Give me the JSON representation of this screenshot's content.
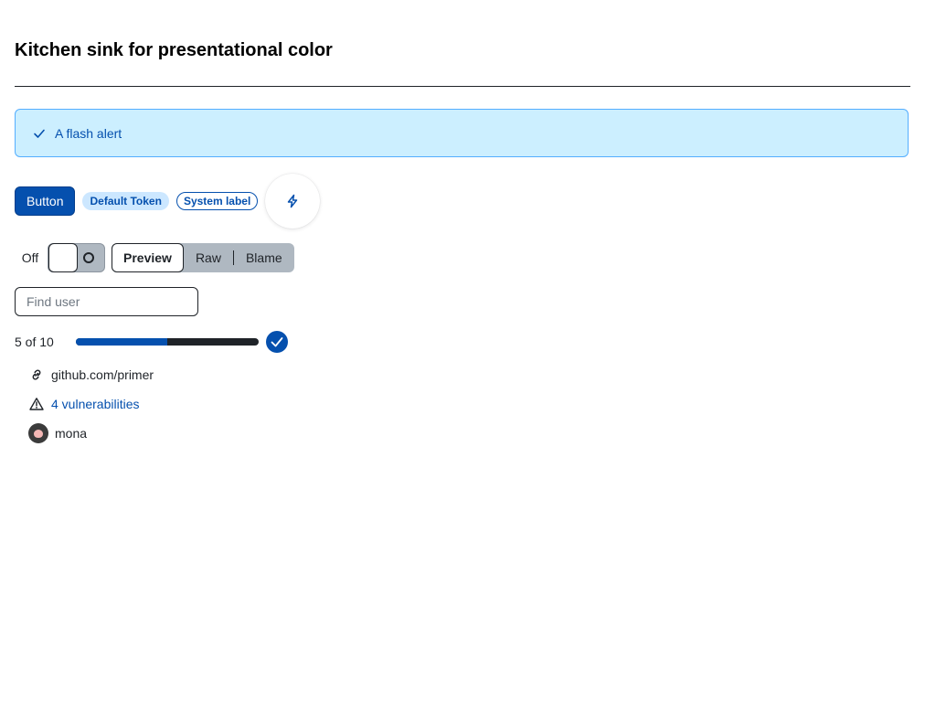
{
  "page_title": "Kitchen sink for presentational color",
  "flash": {
    "message": "A flash alert",
    "icon": "check-icon"
  },
  "actions": {
    "button_label": "Button",
    "token_label": "Default Token",
    "system_label": "System label",
    "icon_button": "zap-icon"
  },
  "toggle": {
    "state_label": "Off",
    "checked": false
  },
  "segmented": {
    "items": [
      "Preview",
      "Raw",
      "Blame"
    ],
    "selected": "Preview"
  },
  "search": {
    "placeholder": "Find user",
    "value": ""
  },
  "progress": {
    "label": "5 of 10",
    "fraction": 0.5
  },
  "details": {
    "link_text": "github.com/primer",
    "vulnerabilities_text": "4 vulnerabilities",
    "user": "mona"
  },
  "colors": {
    "accent": "#0550ae",
    "flash_bg": "#ccefff",
    "flash_border": "#54aeff",
    "token_bg": "#cce7ff",
    "neutral": "#afb8c1"
  }
}
